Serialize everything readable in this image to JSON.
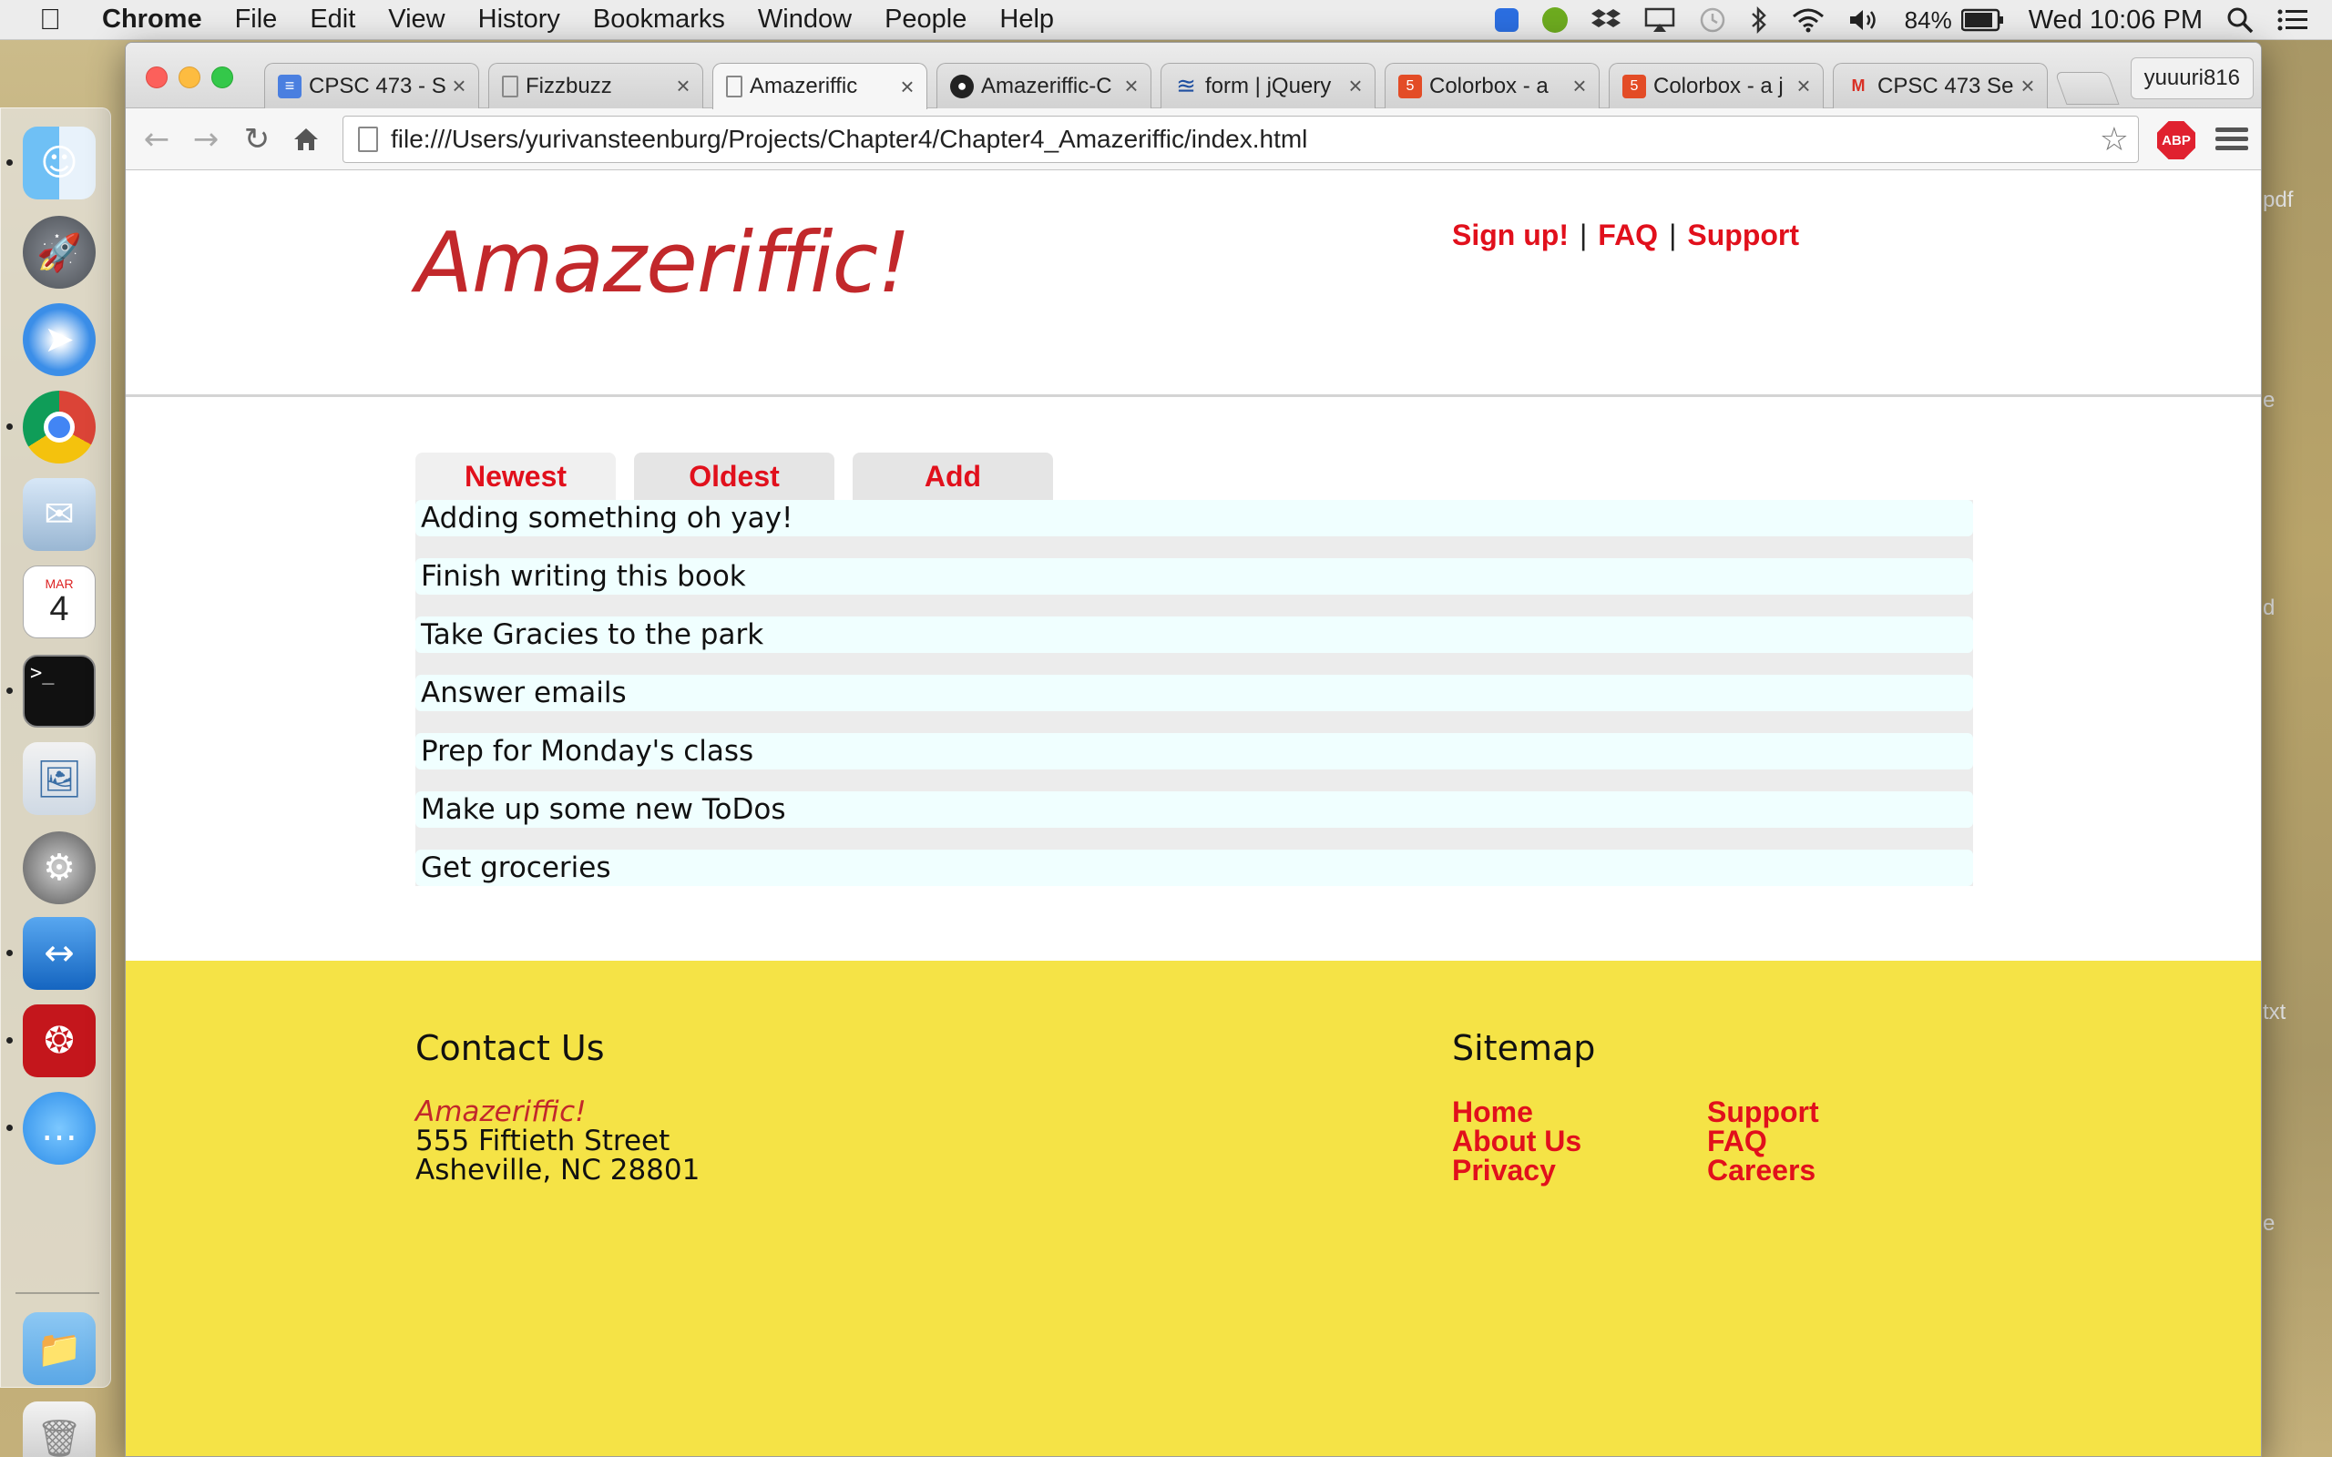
{
  "menubar": {
    "apple": "",
    "app_name": "Chrome",
    "items": [
      "File",
      "Edit",
      "View",
      "History",
      "Bookmarks",
      "Window",
      "People",
      "Help"
    ],
    "battery": "84%",
    "clock": "Wed 10:06 PM",
    "status_icons": [
      "teamviewer-icon",
      "evernote-icon",
      "dropbox-icon",
      "airplay-icon",
      "time-machine-icon",
      "bluetooth-icon",
      "wifi-icon",
      "volume-icon",
      "battery-icon",
      "spotlight-icon",
      "notification-center-icon"
    ]
  },
  "dock": {
    "icons": [
      "finder-icon",
      "launchpad-icon",
      "safari-icon",
      "chrome-icon",
      "mail-icon",
      "calendar-icon",
      "terminal-icon",
      "preview-icon",
      "system-preferences-icon",
      "teamviewer-icon",
      "acrobat-icon",
      "messages-icon",
      "downloads-folder-icon",
      "trash-icon"
    ],
    "calendar_month": "MAR",
    "calendar_day": "4"
  },
  "browser": {
    "tabs": [
      {
        "title": "CPSC 473 - S",
        "icon": "google-docs-icon",
        "color": "#4a7fe0"
      },
      {
        "title": "Fizzbuzz",
        "icon": "page-icon",
        "color": "#ffffff"
      },
      {
        "title": "Amazeriffic",
        "icon": "page-icon",
        "color": "#ffffff"
      },
      {
        "title": "Amazeriffic-C",
        "icon": "github-icon",
        "color": "#222222"
      },
      {
        "title": "form | jQuery",
        "icon": "jquery-icon",
        "color": "#1f4fa0"
      },
      {
        "title": "Colorbox - a",
        "icon": "html5-icon",
        "color": "#e34c26"
      },
      {
        "title": "Colorbox - a j",
        "icon": "html5-icon",
        "color": "#e34c26"
      },
      {
        "title": "CPSC 473 Se",
        "icon": "gmail-icon",
        "color": "#d93025"
      }
    ],
    "active_tab": 2,
    "profile": "yuuuri816",
    "url": "file:///Users/yurivansteenburg/Projects/Chapter4/Chapter4_Amazeriffic/index.html",
    "abp_label": "ABP"
  },
  "site": {
    "logo": "Amazeriffic!",
    "top_links": {
      "signup": "Sign up!",
      "faq": "FAQ",
      "support": "Support",
      "separator": "|"
    },
    "tabs": [
      "Newest",
      "Oldest",
      "Add"
    ],
    "todos": [
      "Adding something oh yay!",
      "Finish writing this book",
      "Take Gracies to the park",
      "Answer emails",
      "Prep for Monday's class",
      "Make up some new ToDos",
      "Get groceries"
    ],
    "footer": {
      "contact_title": "Contact Us",
      "contact_brand": "Amazeriffic!",
      "address_line1": "555 Fiftieth Street",
      "address_line2": "Asheville, NC 28801",
      "sitemap_title": "Sitemap",
      "sitemap_col1": [
        "Home",
        "About Us",
        "Privacy"
      ],
      "sitemap_col2": [
        "Support",
        "FAQ",
        "Careers"
      ]
    }
  },
  "desktop_edge": {
    "labels": [
      "pdf",
      "e",
      "d",
      "txt",
      "e"
    ]
  },
  "colors": {
    "brand_red": "#c2282b",
    "link_red": "#e1101c",
    "footer_yellow": "#f5e346",
    "todo_bg": "#f0ffff"
  }
}
